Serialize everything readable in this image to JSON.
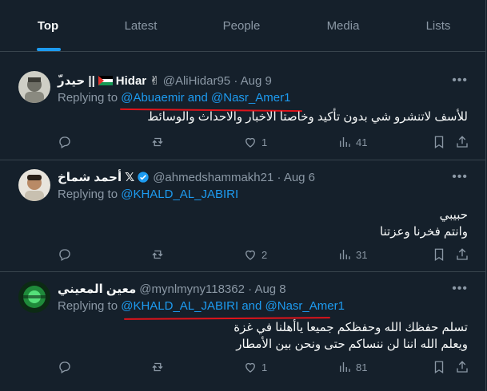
{
  "tabs": [
    {
      "label": "Top",
      "active": true
    },
    {
      "label": "Latest"
    },
    {
      "label": "People"
    },
    {
      "label": "Media"
    },
    {
      "label": "Lists"
    }
  ],
  "posts": [
    {
      "name": "Hidar ✌️ || حيدر ٌ",
      "name_prefix": "ّحيدر ||",
      "name_main": "Hidar",
      "handle": "@AliHidar95 · Aug 9",
      "replying_prefix": "Replying to ",
      "replying_to": "@Abuaemir and @Nasr_Amer1",
      "text": [
        "للأسف لاتنشرو شي بدون تأكيد وخاصتا الاخبار والاحداث والوسائط"
      ],
      "likes": "1",
      "views": "41"
    },
    {
      "name": "أحمد شماخ",
      "handle": "@ahmedshammakh21 · Aug 6",
      "replying_prefix": "Replying to ",
      "replying_to": "@KHALD_AL_JABIRI",
      "text": [
        "حبيبي",
        "وانتم فخرنا وعزتنا"
      ],
      "likes": "2",
      "views": "31"
    },
    {
      "name": "معين المعيني",
      "handle": "@mynlmyny118362 · Aug 8",
      "replying_prefix": "Replying to ",
      "replying_to": "@KHALD_AL_JABIRI and @Nasr_Amer1",
      "text": [
        "تسلم حفظك الله وحفظكم جميعا ياأهلنا في غزة",
        "ويعلم الله اننا لن ننساكم حتى ونحن بين الأمطار"
      ],
      "likes": "1",
      "views": "81"
    }
  ],
  "more_label": "•••",
  "colors": {
    "background": "#15202b",
    "accent": "#1d9bf0",
    "muted": "#8b98a5",
    "divider": "#38444d",
    "annotation": "#e0131a"
  }
}
